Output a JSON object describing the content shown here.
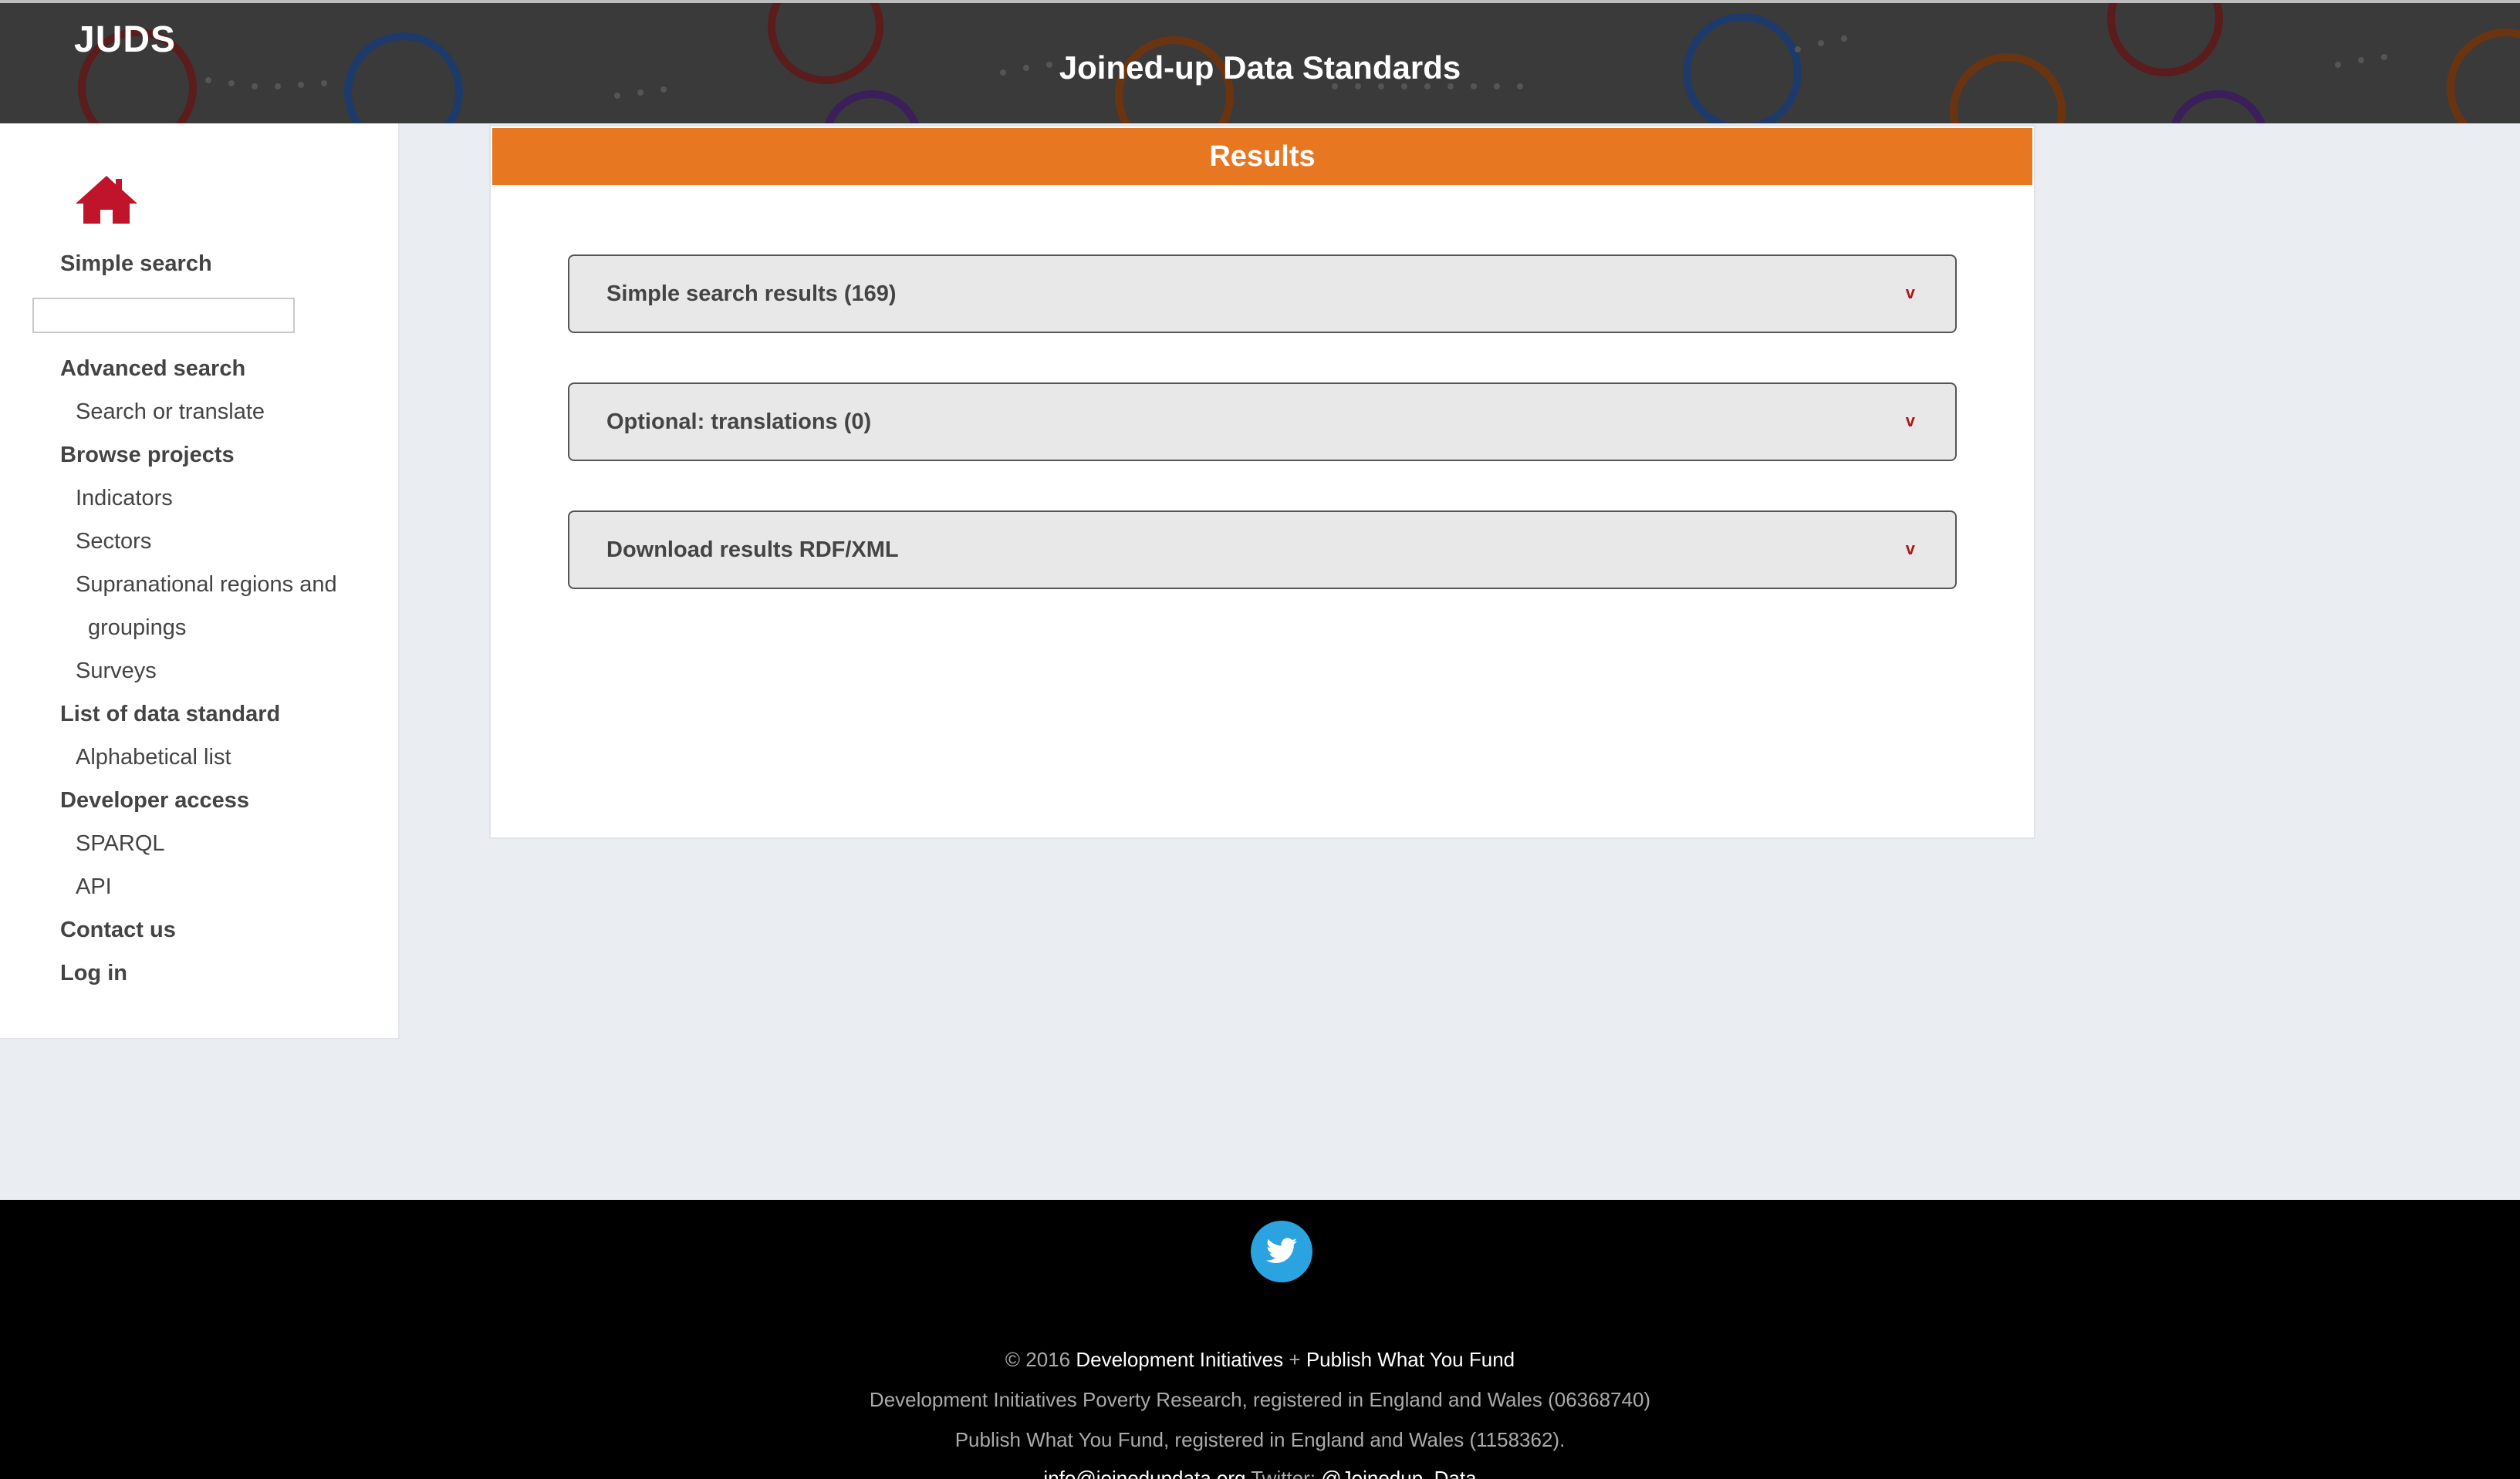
{
  "header": {
    "brand": "JUDS",
    "title": "Joined-up Data Standards"
  },
  "sidebar": {
    "home_icon": "home-icon",
    "simple_search_label": "Simple search",
    "search_value": "",
    "items": [
      {
        "label": "Advanced search",
        "level": "head"
      },
      {
        "label": "Search or translate",
        "level": "sub"
      },
      {
        "label": "Browse projects",
        "level": "head"
      },
      {
        "label": "Indicators",
        "level": "sub"
      },
      {
        "label": "Sectors",
        "level": "sub"
      },
      {
        "label": "Supranational regions and",
        "level": "sub"
      },
      {
        "label": "groupings",
        "level": "sub"
      },
      {
        "label": "Surveys",
        "level": "sub"
      },
      {
        "label": "List of data standard",
        "level": "head"
      },
      {
        "label": "Alphabetical list",
        "level": "sub"
      },
      {
        "label": "Developer access",
        "level": "head"
      },
      {
        "label": "SPARQL",
        "level": "sub"
      },
      {
        "label": "API",
        "level": "sub"
      },
      {
        "label": "Contact us",
        "level": "head"
      },
      {
        "label": "Log in",
        "level": "head"
      }
    ]
  },
  "main": {
    "panel_title": "Results",
    "accordions": [
      {
        "label": "Simple search results (169)",
        "chevron": "v"
      },
      {
        "label": "Optional: translations (0)",
        "chevron": "v"
      },
      {
        "label": "Download results RDF/XML",
        "chevron": "v"
      }
    ]
  },
  "footer": {
    "social_icon": "twitter-icon",
    "copyright_prefix": "© 2016",
    "link_di": "Development Initiatives",
    "plus": "+",
    "link_pwyf": "Publish What You Fund",
    "line2": "Development Initiatives Poverty Research, registered in England and Wales (06368740)",
    "line3": "Publish What You Fund, registered in England and Wales (1158362).",
    "email": "info@joinedupdata.org",
    "twitter_label": "Twitter:",
    "twitter_handle": "@Joinedup_Data"
  },
  "colors": {
    "accent_orange": "#e87722",
    "home_red": "#c0142a",
    "chevron_red": "#b0161e",
    "twitter_blue": "#2aa3e0"
  }
}
